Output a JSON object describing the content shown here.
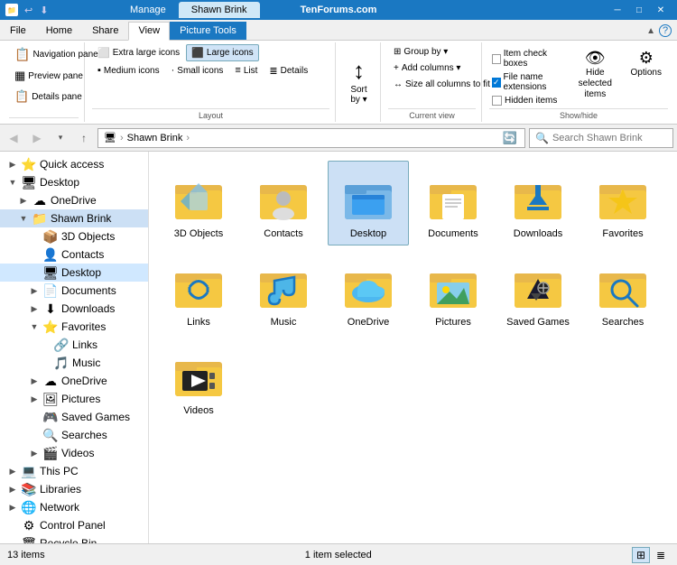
{
  "titlebar": {
    "tabs": [
      "Manage",
      "Shawn Brink"
    ],
    "active_tab": "Manage",
    "highlighted_tab": "Manage",
    "controls": [
      "─",
      "□",
      "✕"
    ],
    "watermark": "TenForums.com"
  },
  "ribbon": {
    "tabs": [
      "File",
      "Home",
      "Share",
      "View",
      "Picture Tools"
    ],
    "active_tab": "View",
    "groups": {
      "panes": {
        "label": "",
        "buttons": [
          "Navigation pane ▾",
          "Preview pane",
          "Details pane"
        ]
      },
      "layout": {
        "label": "Layout",
        "options": [
          "Extra large icons",
          "Large icons",
          "Medium icons",
          "Small icons",
          "List",
          "Details"
        ]
      },
      "current_view": {
        "label": "Current view",
        "buttons": [
          "Group by ▾",
          "Add columns ▾",
          "Size all columns to fit"
        ]
      },
      "show_hide": {
        "label": "Show/hide",
        "checkboxes": [
          {
            "label": "Item check boxes",
            "checked": false
          },
          {
            "label": "File name extensions",
            "checked": true
          },
          {
            "label": "Hidden items",
            "checked": false
          }
        ],
        "hide_selected": "Hide selected\nitems",
        "options": "Options"
      }
    }
  },
  "addressbar": {
    "back": "◀",
    "forward": "▶",
    "up": "↑",
    "path": [
      "🖥",
      "Shawn Brink"
    ],
    "search_placeholder": "Search Shawn Brink",
    "refresh": "🔄"
  },
  "sidebar": {
    "items": [
      {
        "label": "Quick access",
        "icon": "⭐",
        "indent": 0,
        "expanded": true,
        "expander": "▶"
      },
      {
        "label": "Desktop",
        "icon": "🖥",
        "indent": 0,
        "expanded": true,
        "expander": "▼"
      },
      {
        "label": "OneDrive",
        "icon": "☁",
        "indent": 1,
        "expanded": false,
        "expander": "▶"
      },
      {
        "label": "Shawn Brink",
        "icon": "📁",
        "indent": 1,
        "expanded": true,
        "expander": "▼",
        "selected": true
      },
      {
        "label": "3D Objects",
        "icon": "📦",
        "indent": 2,
        "expanded": false,
        "expander": ""
      },
      {
        "label": "Contacts",
        "icon": "👤",
        "indent": 2,
        "expanded": false,
        "expander": ""
      },
      {
        "label": "Desktop",
        "icon": "🖥",
        "indent": 2,
        "expanded": false,
        "expander": "",
        "active": true
      },
      {
        "label": "Documents",
        "icon": "📄",
        "indent": 2,
        "expanded": false,
        "expander": "▶"
      },
      {
        "label": "Downloads",
        "icon": "⬇",
        "indent": 2,
        "expanded": false,
        "expander": "▶"
      },
      {
        "label": "Favorites",
        "icon": "⭐",
        "indent": 2,
        "expanded": true,
        "expander": "▼"
      },
      {
        "label": "Links",
        "icon": "🔗",
        "indent": 3,
        "expanded": false,
        "expander": ""
      },
      {
        "label": "Music",
        "icon": "🎵",
        "indent": 3,
        "expanded": false,
        "expander": ""
      },
      {
        "label": "OneDrive",
        "icon": "☁",
        "indent": 2,
        "expanded": false,
        "expander": "▶"
      },
      {
        "label": "Pictures",
        "icon": "🖼",
        "indent": 2,
        "expanded": false,
        "expander": "▶"
      },
      {
        "label": "Saved Games",
        "icon": "🎮",
        "indent": 2,
        "expanded": false,
        "expander": ""
      },
      {
        "label": "Searches",
        "icon": "🔍",
        "indent": 2,
        "expanded": false,
        "expander": ""
      },
      {
        "label": "Videos",
        "icon": "🎬",
        "indent": 2,
        "expanded": false,
        "expander": "▶"
      },
      {
        "label": "This PC",
        "icon": "💻",
        "indent": 0,
        "expanded": false,
        "expander": "▶"
      },
      {
        "label": "Libraries",
        "icon": "📚",
        "indent": 0,
        "expanded": false,
        "expander": "▶"
      },
      {
        "label": "Network",
        "icon": "🌐",
        "indent": 0,
        "expanded": false,
        "expander": "▶"
      },
      {
        "label": "Control Panel",
        "icon": "⚙",
        "indent": 0,
        "expanded": false,
        "expander": ""
      },
      {
        "label": "Recycle Bin",
        "icon": "🗑",
        "indent": 0,
        "expanded": false,
        "expander": ""
      }
    ]
  },
  "content": {
    "selected_folder": "Desktop",
    "items": [
      {
        "label": "3D Objects",
        "type": "folder",
        "special": "3d"
      },
      {
        "label": "Contacts",
        "type": "folder",
        "special": "contacts"
      },
      {
        "label": "Desktop",
        "type": "folder",
        "special": "desktop",
        "selected": true
      },
      {
        "label": "Documents",
        "type": "folder",
        "special": "documents"
      },
      {
        "label": "Downloads",
        "type": "folder",
        "special": "downloads"
      },
      {
        "label": "Favorites",
        "type": "folder",
        "special": "favorites"
      },
      {
        "label": "Links",
        "type": "folder",
        "special": "links"
      },
      {
        "label": "Music",
        "type": "folder",
        "special": "music"
      },
      {
        "label": "OneDrive",
        "type": "folder",
        "special": "onedrive"
      },
      {
        "label": "Pictures",
        "type": "folder",
        "special": "pictures"
      },
      {
        "label": "Saved Games",
        "type": "folder",
        "special": "saved-games"
      },
      {
        "label": "Searches",
        "type": "folder",
        "special": "searches"
      },
      {
        "label": "Videos",
        "type": "folder",
        "special": "videos"
      }
    ]
  },
  "statusbar": {
    "count": "13 items",
    "selected": "1 item selected",
    "views": [
      "large-icons",
      "details"
    ]
  }
}
